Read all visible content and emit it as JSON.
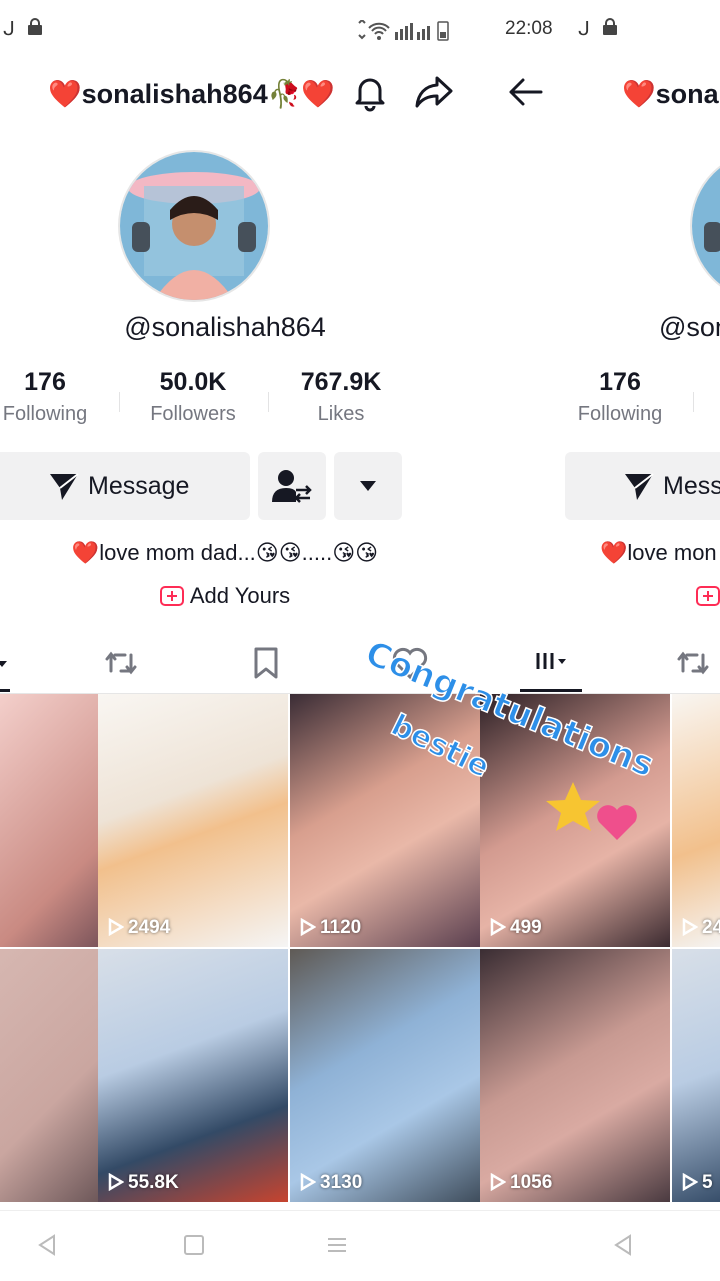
{
  "status": {
    "time": "22:08",
    "notif_icon": "ᒍ"
  },
  "profile": {
    "display_title": "sonalishah864",
    "heart_prefix": "❤️",
    "title_suffix": "🥀❤️",
    "title_suffix_right": "",
    "handle": "@sonalishah864",
    "stats": [
      {
        "value": "176",
        "label": "Following"
      },
      {
        "value": "50.0K",
        "label": "Followers"
      },
      {
        "value": "767.9K",
        "label": "Likes"
      }
    ],
    "message_label": "Message",
    "bio": "❤️love mom dad...😘😘.....😘😘",
    "add_yours": "Add Yours"
  },
  "right_profile": {
    "title": "❤️sonal",
    "handle": "@son",
    "stats": [
      {
        "value": "176",
        "label": "Following"
      }
    ],
    "message_label": "Mess",
    "bio": "❤️love mon"
  },
  "videos": [
    {
      "views": ""
    },
    {
      "views": "2494"
    },
    {
      "views": "1120"
    },
    {
      "views": "499"
    },
    {
      "views": ""
    },
    {
      "views": "55.8K"
    },
    {
      "views": "3130"
    },
    {
      "views": "1056"
    }
  ],
  "right_videos": [
    {
      "views": "24"
    },
    {
      "views": "5"
    }
  ],
  "sticker": {
    "line1": "Congratulations",
    "line2": "bestie"
  },
  "colors": {
    "accent": "#fe2c55",
    "text": "#161823",
    "muted": "#757780",
    "button": "#f1f1f2"
  }
}
